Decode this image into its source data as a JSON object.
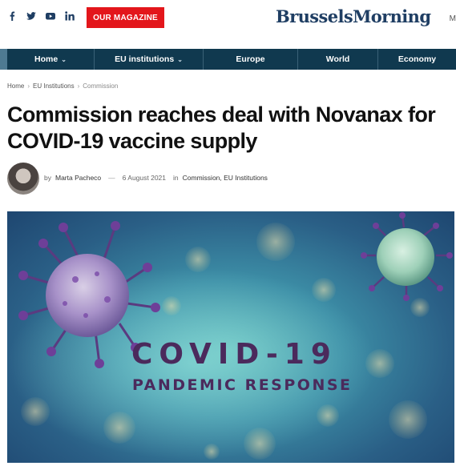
{
  "topbar": {
    "social": [
      "facebook-icon",
      "twitter-icon",
      "youtube-icon",
      "linkedin-icon"
    ],
    "magazine_button": "OUR MAGAZINE",
    "logo_part1": "Brussels",
    "logo_part2": "Morning",
    "menu_letter": "M"
  },
  "nav": {
    "items": [
      {
        "label": "Home",
        "dropdown": true
      },
      {
        "label": "EU institutions",
        "dropdown": true
      },
      {
        "label": "Europe",
        "dropdown": false
      },
      {
        "label": "World",
        "dropdown": false
      },
      {
        "label": "Economy",
        "dropdown": false
      }
    ]
  },
  "breadcrumb": {
    "items": [
      "Home",
      "EU Institutions",
      "Commission"
    ]
  },
  "article": {
    "title": "Commission reaches deal with Novanax for COVID-19 vaccine supply",
    "by": "by",
    "author": "Marta Pacheco",
    "date": "6 August 2021",
    "in": "in",
    "categories": "Commission, EU Institutions"
  },
  "hero": {
    "line1": "COVID-19",
    "line2": "PANDEMIC RESPONSE"
  },
  "colors": {
    "nav_bg": "#10394f",
    "accent_red": "#e3161b",
    "logo": "#1f3e63"
  }
}
